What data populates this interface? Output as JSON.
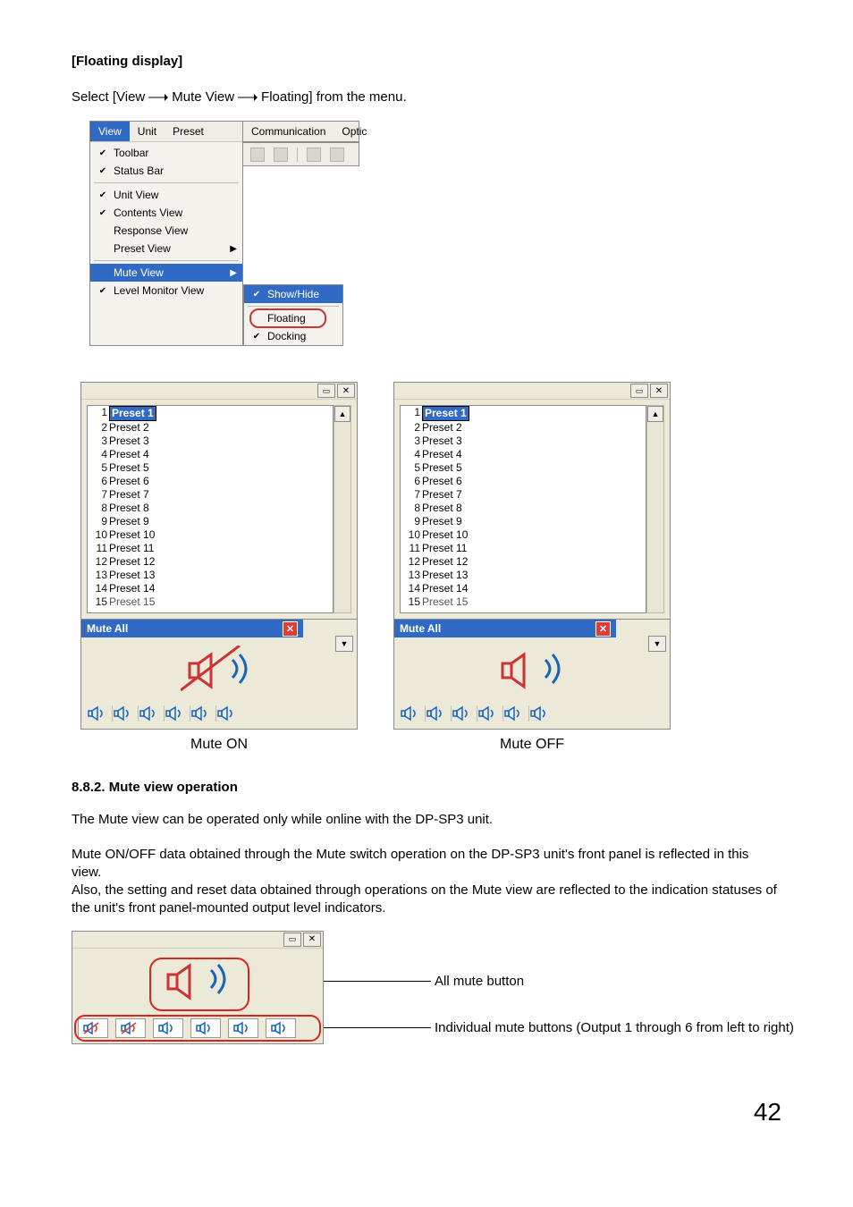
{
  "heading": "[Floating display]",
  "instruction": {
    "pre": "Select [View",
    "mid1": "Mute View",
    "mid2": "Floating] from the menu."
  },
  "menu": {
    "bar": [
      "View",
      "Unit",
      "Preset",
      "Communication",
      "Optic"
    ],
    "items": [
      {
        "label": "Toolbar",
        "checked": true
      },
      {
        "label": "Status Bar",
        "checked": true
      },
      {
        "sep": true
      },
      {
        "label": "Unit View",
        "checked": true
      },
      {
        "label": "Contents View",
        "checked": true
      },
      {
        "label": "Response View",
        "checked": false
      },
      {
        "label": "Preset View",
        "checked": false,
        "arrow": true
      },
      {
        "sep": true
      },
      {
        "label": "Mute View",
        "checked": false,
        "arrow": true,
        "sel": true
      },
      {
        "label": "Level Monitor View",
        "checked": true
      }
    ],
    "submenu": [
      {
        "label": "Show/Hide",
        "checked": true,
        "sel": true
      },
      {
        "sep": true
      },
      {
        "label": "Floating",
        "checked": false,
        "circle": true
      },
      {
        "label": "Docking",
        "checked": true
      }
    ]
  },
  "panels": {
    "mute_title": "Mute All",
    "presets": [
      "Preset 1",
      "Preset 2",
      "Preset 3",
      "Preset 4",
      "Preset 5",
      "Preset 6",
      "Preset 7",
      "Preset 8",
      "Preset 9",
      "Preset 10",
      "Preset 11",
      "Preset 12",
      "Preset 13",
      "Preset 14",
      "Preset 15"
    ],
    "caption_on": "Mute ON",
    "caption_off": "Mute OFF"
  },
  "section2": {
    "heading": "8.8.2. Mute view operation",
    "p1": "The Mute view can be operated only while online with the DP-SP3 unit.",
    "p2": "Mute ON/OFF data obtained through the Mute switch operation on the DP-SP3 unit's front panel is reflected in this view.",
    "p3": "Also, the setting and reset data obtained through operations on the Mute view are reflected to the indication statuses of the unit's front panel-mounted output level indicators."
  },
  "annotations": {
    "all_mute": "All mute button",
    "individual": "Individual mute buttons (Output 1 through 6 from left to right)"
  },
  "pagenum": "42"
}
